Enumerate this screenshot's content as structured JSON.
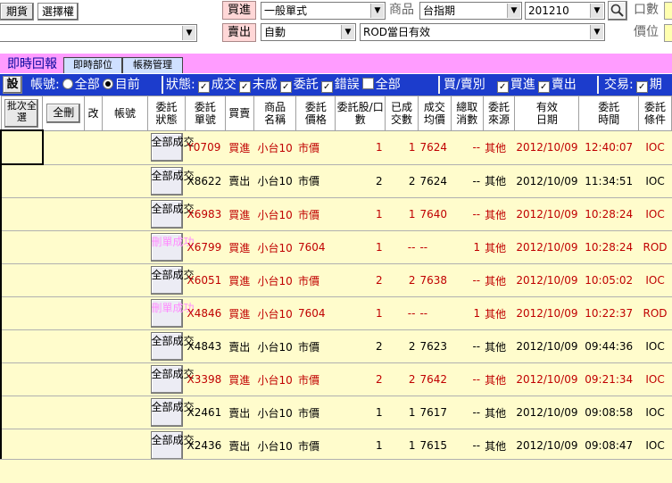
{
  "toolbar": {
    "futures_btn": "期貨",
    "options_btn": "選擇權",
    "buy_btn": "買進",
    "sell_btn": "賣出",
    "order_type": "一般單式",
    "product_label": "商品",
    "product": "台指期",
    "contract_month": "201210",
    "qty_label": "口數",
    "price_label": "價位",
    "auto": "自動",
    "tif": "ROD當日有效"
  },
  "tabs": [
    "即時回報",
    "即時部位",
    "帳務管理"
  ],
  "filters": {
    "settings_btn": "設",
    "account_label": "帳號:",
    "account_all": "全部",
    "account_current": "目前",
    "status_label": "狀態:",
    "status_options": [
      "成交",
      "未成",
      "委託",
      "錯誤",
      "全部"
    ],
    "side_label": "買/賣別",
    "side_options": [
      "買進",
      "賣出"
    ],
    "trade_label": "交易:",
    "trade_option": "期"
  },
  "columns": {
    "batch_select": "批次全選",
    "delete_all": "全刪",
    "modify": "改",
    "account": "帳號",
    "order_status": "委託狀態",
    "order_no": "委託單號",
    "side": "買賣",
    "product_name": "商品名稱",
    "order_price": "委託價格",
    "order_qty": "委託股/口數",
    "filled_qty": "已成交數",
    "avg_price": "成交均價",
    "cancel_qty": "總取消數",
    "source": "委託來源",
    "valid_date": "有效日期",
    "order_time": "委託時間",
    "condition": "委託條件"
  },
  "rows": [
    {
      "status": "全部成交",
      "no": "Y0709",
      "side": "買進",
      "prod": "小台10",
      "price": "市價",
      "qty": "1",
      "filled": "1",
      "avg": "7624",
      "cancel": "--",
      "src": "其他",
      "date": "2012/10/09",
      "time": "12:40:07",
      "cond": "IOC",
      "color": "red"
    },
    {
      "status": "全部成交",
      "no": "X8622",
      "side": "賣出",
      "prod": "小台10",
      "price": "市價",
      "qty": "2",
      "filled": "2",
      "avg": "7624",
      "cancel": "--",
      "src": "其他",
      "date": "2012/10/09",
      "time": "11:34:51",
      "cond": "IOC",
      "color": "black"
    },
    {
      "status": "全部成交",
      "no": "X6983",
      "side": "買進",
      "prod": "小台10",
      "price": "市價",
      "qty": "1",
      "filled": "1",
      "avg": "7640",
      "cancel": "--",
      "src": "其他",
      "date": "2012/10/09",
      "time": "10:28:24",
      "cond": "IOC",
      "color": "red"
    },
    {
      "status": "刪單成功",
      "no": "X6799",
      "side": "買進",
      "prod": "小台10",
      "price": "7604",
      "qty": "1",
      "filled": "--",
      "avg": "--",
      "cancel": "1",
      "src": "其他",
      "date": "2012/10/09",
      "time": "10:28:24",
      "cond": "ROD",
      "color": "red"
    },
    {
      "status": "全部成交",
      "no": "X6051",
      "side": "買進",
      "prod": "小台10",
      "price": "市價",
      "qty": "2",
      "filled": "2",
      "avg": "7638",
      "cancel": "--",
      "src": "其他",
      "date": "2012/10/09",
      "time": "10:05:02",
      "cond": "IOC",
      "color": "red"
    },
    {
      "status": "刪單成功",
      "no": "X4846",
      "side": "買進",
      "prod": "小台10",
      "price": "7604",
      "qty": "1",
      "filled": "--",
      "avg": "--",
      "cancel": "1",
      "src": "其他",
      "date": "2012/10/09",
      "time": "10:22:37",
      "cond": "ROD",
      "color": "red"
    },
    {
      "status": "全部成交",
      "no": "X4843",
      "side": "賣出",
      "prod": "小台10",
      "price": "市價",
      "qty": "2",
      "filled": "2",
      "avg": "7623",
      "cancel": "--",
      "src": "其他",
      "date": "2012/10/09",
      "time": "09:44:36",
      "cond": "IOC",
      "color": "black"
    },
    {
      "status": "全部成交",
      "no": "X3398",
      "side": "買進",
      "prod": "小台10",
      "price": "市價",
      "qty": "2",
      "filled": "2",
      "avg": "7642",
      "cancel": "--",
      "src": "其他",
      "date": "2012/10/09",
      "time": "09:21:34",
      "cond": "IOC",
      "color": "red"
    },
    {
      "status": "全部成交",
      "no": "X2461",
      "side": "賣出",
      "prod": "小台10",
      "price": "市價",
      "qty": "1",
      "filled": "1",
      "avg": "7617",
      "cancel": "--",
      "src": "其他",
      "date": "2012/10/09",
      "time": "09:08:58",
      "cond": "IOC",
      "color": "black"
    },
    {
      "status": "全部成交",
      "no": "X2436",
      "side": "賣出",
      "prod": "小台10",
      "price": "市價",
      "qty": "1",
      "filled": "1",
      "avg": "7615",
      "cancel": "--",
      "src": "其他",
      "date": "2012/10/09",
      "time": "09:08:47",
      "cond": "IOC",
      "color": "black"
    }
  ]
}
